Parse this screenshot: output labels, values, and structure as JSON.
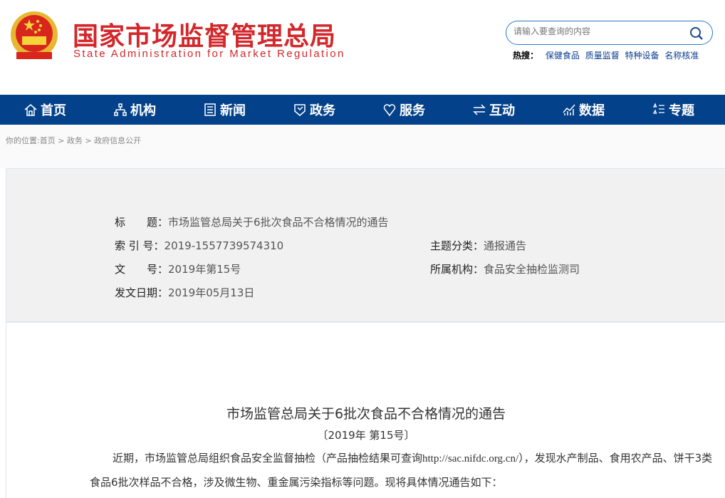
{
  "header": {
    "logo_cn": "国家市场监督管理总局",
    "logo_en": "State Administration for Market Regulation",
    "search_placeholder": "请输入要查询的内容",
    "hot_label": "热搜：",
    "hot_links": [
      "保健食品",
      "质量监督",
      "特种设备",
      "名称核准"
    ]
  },
  "nav": [
    {
      "label": "首页",
      "icon": "home-icon"
    },
    {
      "label": "机构",
      "icon": "org-icon"
    },
    {
      "label": "新闻",
      "icon": "news-icon"
    },
    {
      "label": "政务",
      "icon": "shield-icon"
    },
    {
      "label": "服务",
      "icon": "heart-icon"
    },
    {
      "label": "互动",
      "icon": "swap-icon"
    },
    {
      "label": "数据",
      "icon": "chart-icon"
    },
    {
      "label": "专题",
      "icon": "star-list-icon"
    }
  ],
  "breadcrumb": "你的位置:首页 > 政务 > 政府信息公开",
  "meta": {
    "title_label": "标　　题：",
    "title_value": "市场监管总局关于6批次食品不合格情况的通告",
    "index_label": "索 引 号：",
    "index_value": "2019-1557739574310",
    "category_label": "主题分类：",
    "category_value": "通报通告",
    "doc_label": "文　　号：",
    "doc_value": "2019年第15号",
    "org_label": "所属机构：",
    "org_value": "食品安全抽检监测司",
    "date_label": "发文日期：",
    "date_value": "2019年05月13日"
  },
  "article": {
    "title": "市场监管总局关于6批次食品不合格情况的通告",
    "number": "〔2019年 第15号〕",
    "p1a": "近期，市场监管总局组织食品安全监督抽检（产品抽检结果可查询",
    "url": "http://sac.nifdc.org.cn/",
    "p1b": "），发现水产制品、食用农产品、饼干3类食品6批次样品不合格，涉及微生物、重金属污染指标等问题。现将具体情况通告如下："
  }
}
